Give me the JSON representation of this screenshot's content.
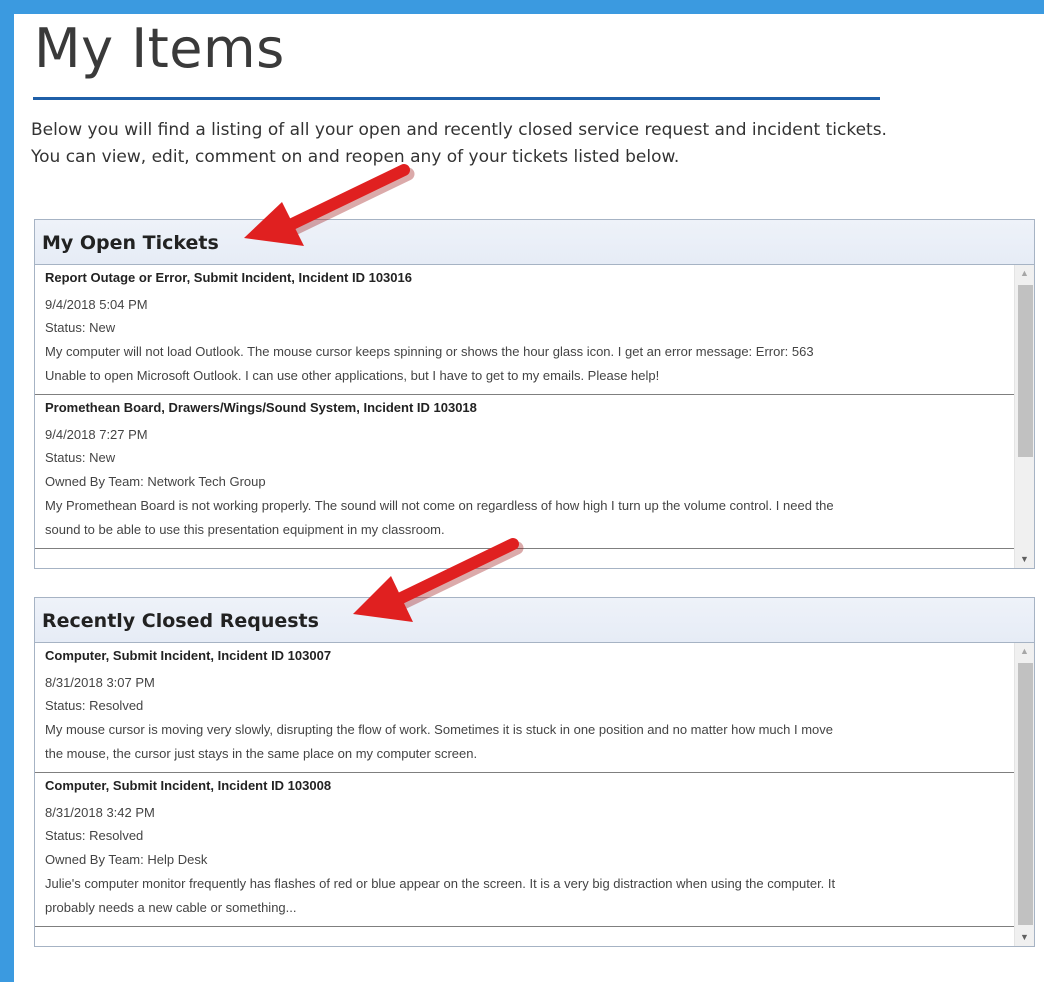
{
  "page": {
    "title": "My Items",
    "intro_line1": "Below you will find a listing of all your open and recently closed service request and incident tickets.",
    "intro_line2": "You can view, edit, comment on and reopen any of your tickets listed below.",
    "accent_color": "#3b9ae0",
    "annotation_arrow_color": "#e02020"
  },
  "open_tickets": {
    "title": "My Open Tickets",
    "items": [
      {
        "title": "Report Outage or Error, Submit Incident, Incident ID 103016",
        "date": "9/4/2018 5:04 PM",
        "status": "Status: New",
        "desc1": "My computer will not load Outlook. The mouse cursor keeps spinning or shows the hour glass icon. I get an error message: Error: 563",
        "desc2": "Unable to open Microsoft Outlook. I can use other applications, but I have to get to my emails. Please help!"
      },
      {
        "title": "Promethean Board, Drawers/Wings/Sound System, Incident ID 103018",
        "date": "9/4/2018 7:27 PM",
        "status": "Status: New",
        "owner": "Owned By Team: Network Tech Group",
        "desc1": "My Promethean Board is not working properly. The sound will not come on regardless of how high I turn up the volume control. I need the",
        "desc2": "sound to be able to use this presentation equipment in my classroom."
      }
    ]
  },
  "closed_requests": {
    "title": "Recently Closed Requests",
    "items": [
      {
        "title": "Computer, Submit Incident, Incident ID 103007",
        "date": "8/31/2018 3:07 PM",
        "status": "Status: Resolved",
        "desc1": "My mouse cursor is moving very slowly, disrupting the flow of work. Sometimes it is stuck in one position and no matter how much I move",
        "desc2": "the mouse, the cursor just stays in the same place on my computer screen."
      },
      {
        "title": "Computer, Submit Incident, Incident ID 103008",
        "date": "8/31/2018 3:42 PM",
        "status": "Status: Resolved",
        "owner": "Owned By Team: Help Desk",
        "desc1": "Julie's computer monitor frequently has flashes of red or blue appear on the screen. It is a very big distraction when using the computer. It",
        "desc2": "probably needs a new cable or something..."
      }
    ]
  }
}
